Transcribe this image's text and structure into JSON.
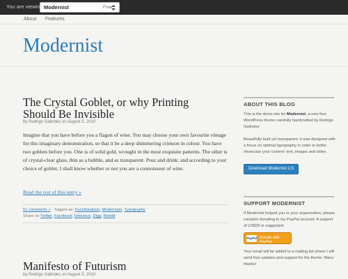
{
  "topbar": {
    "viewing_label": "You are viewing",
    "theme_name": "Modernist",
    "theme_price": "Free"
  },
  "nav": {
    "about": "About",
    "features": "Features"
  },
  "site_title": "Modernist",
  "posts": [
    {
      "title_line1": "The Crystal Goblet, or why Printing",
      "title_line2": "Should Be Invisible",
      "byline": "by Rodrigo Galindez on August 5, 2010",
      "excerpt": "Imagine that you have before you a flagon of wine. You may choose your own favourite vintage for this imaginary demonstration, so that it be a deep shimmering crimson in colour. You have two goblets before you. One is of solid gold, wrought in the most exquisite patterns. The other is of crystal-clear glass, thin as a bubble, and as transparent. Pour and drink; and according to your choice of goblet, I shall know whether or not you are a connoisseur of wine.",
      "read_more": "Read the rest of this entry »",
      "comments": "51 comments »",
      "tagged_label": "Tagged as:",
      "tags": [
        "Functionalism",
        "Modernism",
        "Typography"
      ],
      "share_label": "Share on",
      "share_links": [
        "Twitter",
        "Facebook",
        "Delicious",
        "Digg",
        "Reddit"
      ]
    },
    {
      "title_line1": "Manifesto of Futurism",
      "byline": "by Rodrigo Galindez on August 5, 2010"
    }
  ],
  "sidebar": {
    "about": {
      "heading": "ABOUT THIS BLOG",
      "text_before": "This is the demo site for",
      "text_bold": "Modernist",
      "text_after": ", a new free WordPress theme carefully handcrafted by Rodrigo Galindez",
      "text2": "Beautifully built yet transparent, it was designed with a focus on optimal typography in order to better showcase your content: text, images and video.",
      "button": "Download Modernist 2.5"
    },
    "support": {
      "heading": "SUPPORT MODERNIST",
      "text": "If Modernist helped you or your organization, please consider donating to my PayPal account. A support of US$25 is suggested.",
      "paypal_logo": "PayPal",
      "button": "Donate with PayPal",
      "text2": "Your email will be added to a mailing list where I will send free updates and support for the theme. Many thanks!"
    }
  },
  "colors": {
    "accent": "#2b7bb9",
    "topbar": "#2b2b2b",
    "paypal": "#f0a01d"
  }
}
